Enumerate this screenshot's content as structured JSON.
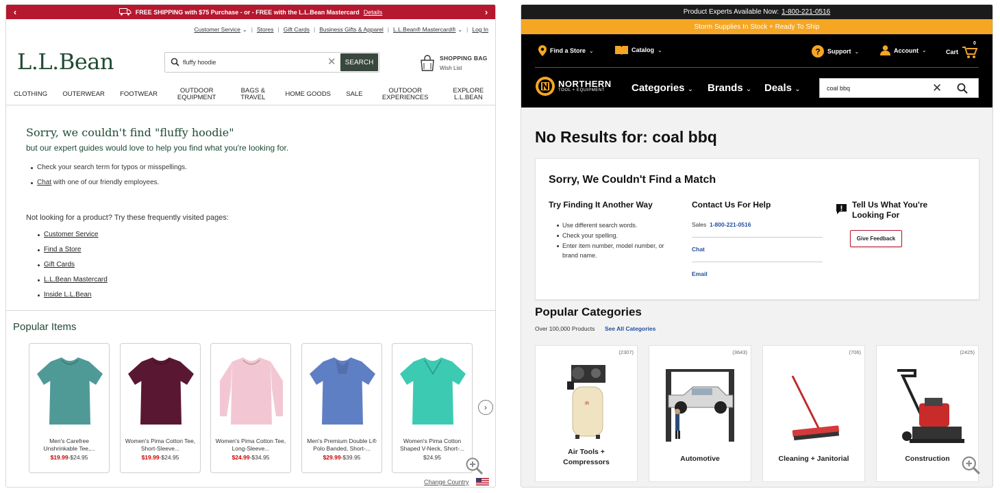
{
  "llbean": {
    "promo": {
      "text": "FREE SHIPPING with $75 Purchase - or - FREE with the L.L.Bean Mastercard",
      "details": "Details",
      "prev": "‹",
      "next": "›"
    },
    "utility": {
      "customer_service": "Customer Service",
      "stores": "Stores",
      "gift_cards": "Gift Cards",
      "business": "Business Gifts & Apparel",
      "mastercard": "L.L.Bean® Mastercard®",
      "login": "Log In"
    },
    "logo": "L.L.Bean",
    "search": {
      "value": "fluffy hoodie",
      "button": "SEARCH"
    },
    "bag": {
      "title": "SHOPPING BAG",
      "wishlist": "Wish List"
    },
    "nav": [
      "CLOTHING",
      "OUTERWEAR",
      "FOOTWEAR",
      "OUTDOOR EQUIPMENT",
      "BAGS & TRAVEL",
      "HOME GOODS",
      "SALE",
      "OUTDOOR EXPERIENCES",
      "EXPLORE L.L.BEAN"
    ],
    "sorry": "Sorry, we couldn't find \"fluffy hoodie\"",
    "subtitle": "but our expert guides would love to help you find what you're looking for.",
    "tip1": "Check your search term for typos or misspellings.",
    "tip2_link": "Chat",
    "tip2_rest": " with one of our friendly employees.",
    "not_looking": "Not looking for a product? Try these frequently visited pages:",
    "links": [
      "Customer Service",
      "Find a Store",
      "Gift Cards",
      "L.L.Bean Mastercard",
      "Inside L.L.Bean"
    ],
    "popular_title": "Popular Items",
    "products": [
      {
        "name": "Men's Carefree Unshrinkable Tee,...",
        "sale": "$19.99",
        "regular": "-$24.95",
        "color": "#4f9a96"
      },
      {
        "name": "Women's Pima Cotton Tee, Short-Sleeve...",
        "sale": "$19.99",
        "regular": "-$24.95",
        "color": "#5a1732"
      },
      {
        "name": "Women's Pima Cotton Tee, Long-Sleeve...",
        "sale": "$24.99",
        "regular": "-$34.95",
        "color": "#f2c7d3"
      },
      {
        "name": "Men's Premium Double L® Polo Banded, Short-...",
        "sale": "$29.99",
        "regular": "-$39.95",
        "color": "#5f7fc4"
      },
      {
        "name": "Women's Pima Cotton Shaped V-Neck, Short-...",
        "sale": "",
        "regular": "$24.95",
        "color": "#3ccab2"
      }
    ],
    "change_country": "Change Country"
  },
  "northern": {
    "experts": "Product Experts Available Now:",
    "phone": "1-800-221-0516",
    "storm": "Storm Supplies In Stock + Ready To Ship",
    "find_store": "Find a Store",
    "catalog": "Catalog",
    "support": "Support",
    "account": "Account",
    "cart": "Cart",
    "cart_count": "0",
    "logo_main": "NORTHERN",
    "logo_sub": "TOOL + EQUIPMENT",
    "nav": [
      "Categories",
      "Brands",
      "Deals"
    ],
    "search_value": "coal bbq",
    "no_results": "No Results for: coal bbq",
    "box_title": "Sorry, We Couldn't Find a Match",
    "try_title": "Try Finding It Another Way",
    "tips": [
      "Use different search words.",
      "Check your spelling.",
      "Enter item number, model number, or brand name."
    ],
    "contact_title": "Contact Us For Help",
    "sales_label": "Sales",
    "sales_phone": "1-800-221-0516",
    "chat": "Chat",
    "email": "Email",
    "tell_title": "Tell Us What You're Looking For",
    "feedback_btn": "Give Feedback",
    "popular_title": "Popular Categories",
    "over": "Over 100,000 Products",
    "see_all": "See All Categories",
    "categories": [
      {
        "name": "Air Tools + Compressors",
        "count": "(2307)"
      },
      {
        "name": "Automotive",
        "count": "(3643)"
      },
      {
        "name": "Cleaning + Janitorial",
        "count": "(706)"
      },
      {
        "name": "Construction",
        "count": "(2425)"
      }
    ]
  },
  "colors": {
    "llbean_red": "#b5182f",
    "llbean_green": "#1f4a33",
    "northern_orange": "#f5a623",
    "northern_blue": "#1f4e9c",
    "sale_red": "#c00000"
  },
  "icons": [
    "truck-icon",
    "search-icon",
    "close-icon",
    "shopping-bag-icon",
    "chevron-right-icon",
    "zoom-in-icon",
    "us-flag-icon",
    "location-pin-icon",
    "catalog-icon",
    "help-icon",
    "account-icon",
    "cart-icon",
    "feedback-icon"
  ]
}
